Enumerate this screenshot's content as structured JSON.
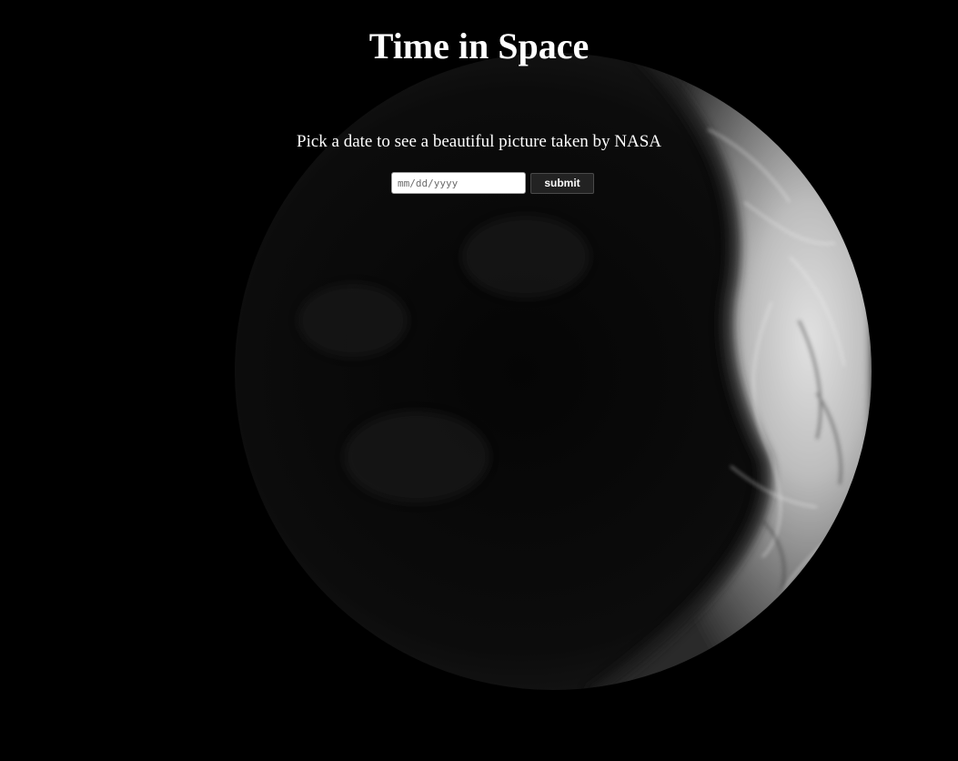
{
  "page": {
    "title": "Time in Space",
    "subtitle": "Pick a date to see a beautiful picture taken by NASA"
  },
  "form": {
    "date_placeholder": "mm/dd/yyyy",
    "date_value": "",
    "submit_label": "submit"
  },
  "background": {
    "image_subject": "crescent-moon-photo",
    "colors": {
      "space": "#000000",
      "moon_lit": "#d9d9d9",
      "moon_shadow": "#0a0a0a"
    }
  }
}
